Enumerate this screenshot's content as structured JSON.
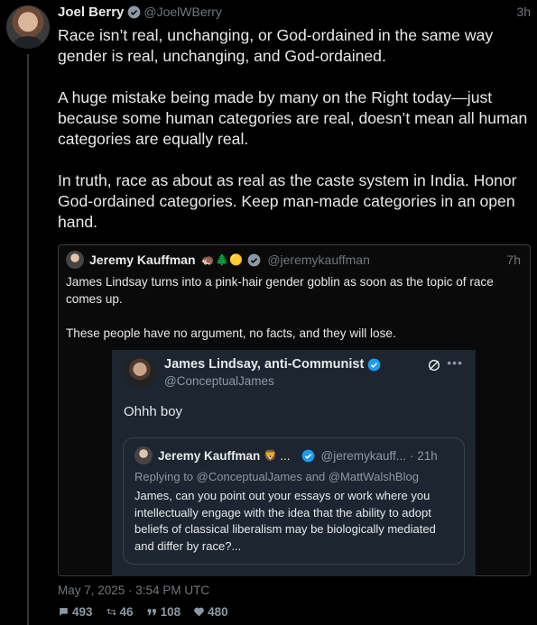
{
  "post": {
    "author_name": "Joel Berry",
    "author_handle": "@JoelWBerry",
    "time": "3h",
    "text": "Race isn’t real, unchanging, or God-ordained in the same way gender is real, unchanging, and God-ordained.\n\nA huge mistake being made by many on the Right today—just because some human categories are real, doesn’t mean all human categories are equally real.\n\nIn truth, race as about as real as the caste system in India. Honor God-ordained categories. Keep man-made categories in an open hand.",
    "timestamp": "May 7, 2025 · 3:54 PM UTC",
    "stats": {
      "replies": "493",
      "retweets": "46",
      "quotes": "108",
      "likes": "480"
    }
  },
  "quote": {
    "author_name": "Jeremy Kauffman",
    "emojis": "🦔🌲🟡",
    "author_handle": "@jeremykauffman",
    "time": "7h",
    "text": "James Lindsay turns into a pink-hair gender goblin as soon as the topic of race comes up.\n\nThese people have no argument, no facts, and they will lose."
  },
  "screenshot": {
    "author_name": "James Lindsay, anti-Communist",
    "author_handle": "@ConceptualJames",
    "text": "Ohhh boy",
    "inner": {
      "author_name": "Jeremy Kauffman",
      "emoji": "🦁",
      "author_handle": "@jeremykauff...",
      "time": "· 21h",
      "replying_to": "Replying to @ConceptualJames and @MattWalshBlog",
      "text": "James, can you point out your essays or work where you intellectually engage with the idea that the ability to adopt beliefs of classical liberalism may be biologically mediated and differ by race?..."
    }
  },
  "colors": {
    "background": "#000000",
    "text": "#e7e9ea",
    "muted": "#71767b",
    "verified": "#1d9bf0",
    "border": "#3a3d42"
  }
}
